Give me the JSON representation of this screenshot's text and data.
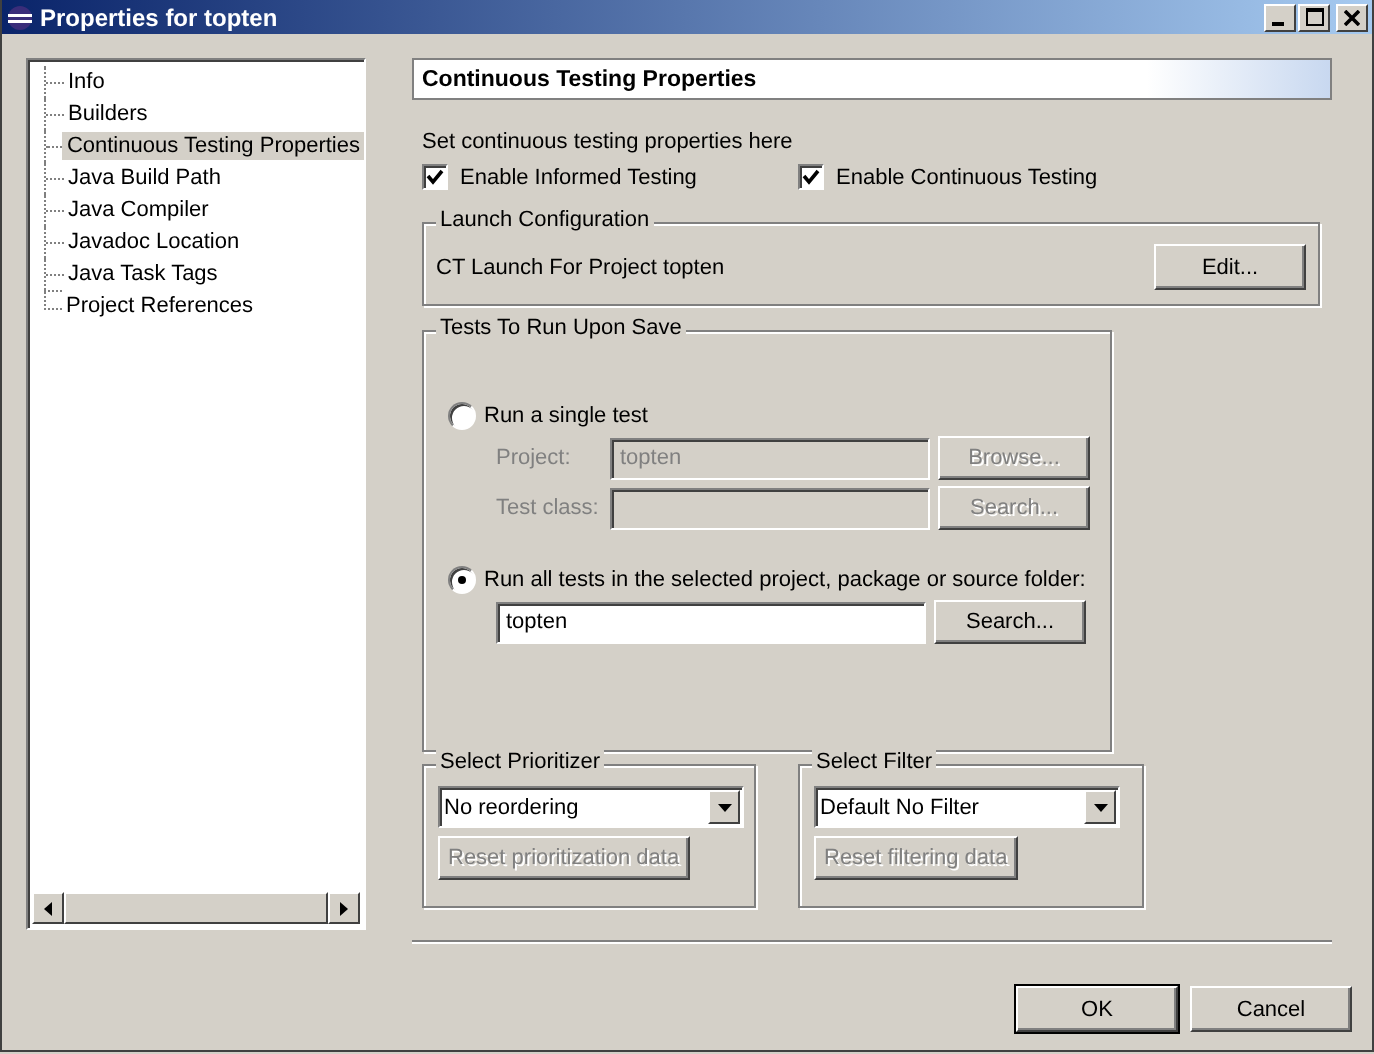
{
  "window": {
    "title": "Properties for topten"
  },
  "sidebar": {
    "items": [
      {
        "label": "Info",
        "selected": false
      },
      {
        "label": "Builders",
        "selected": false
      },
      {
        "label": "Continuous Testing Properties",
        "selected": true
      },
      {
        "label": "Java Build Path",
        "selected": false
      },
      {
        "label": "Java Compiler",
        "selected": false
      },
      {
        "label": "Javadoc Location",
        "selected": false
      },
      {
        "label": "Java Task Tags",
        "selected": false
      },
      {
        "label": "Project References",
        "selected": false
      }
    ]
  },
  "page": {
    "title": "Continuous Testing Properties",
    "description": "Set continuous testing properties here",
    "checkboxes": [
      {
        "label": "Enable Informed Testing",
        "checked": true
      },
      {
        "label": "Enable Continuous Testing",
        "checked": true
      }
    ],
    "launch_configuration": {
      "legend": "Launch Configuration",
      "text": "CT Launch For Project topten",
      "button": "Edit..."
    },
    "tests": {
      "legend": "Tests To Run Upon Save",
      "options": [
        {
          "label": "Run a single test",
          "selected": false,
          "fields": [
            {
              "label": "Project:",
              "value": "topten",
              "button": "Browse...",
              "disabled": true
            },
            {
              "label": "Test class:",
              "button": "Search...",
              "disabled": true
            }
          ]
        },
        {
          "label": "Run all tests in the selected project, package or source folder:",
          "selected": true,
          "fields": [
            {
              "value": "topten",
              "button": "Search...",
              "disabled": false
            }
          ]
        }
      ]
    },
    "groups": [
      {
        "legend": "Select Prioritizer",
        "value": "No reordering",
        "button": "Reset prioritization data",
        "button_disabled": true
      },
      {
        "legend": "Select Filter",
        "value": "Default No Filter",
        "button": "Reset filtering data",
        "button_disabled": true
      }
    ]
  },
  "buttons": [
    {
      "label": "OK",
      "default": true
    },
    {
      "label": "Cancel",
      "default": false
    }
  ]
}
